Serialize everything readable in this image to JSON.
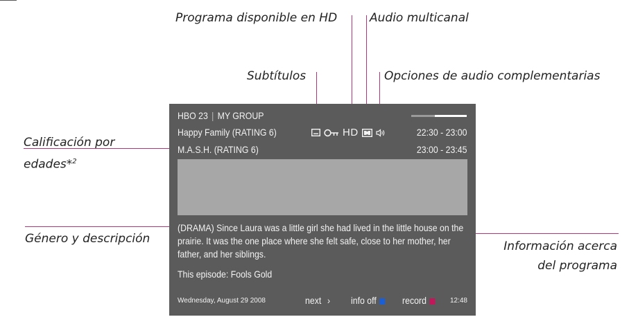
{
  "annotations": {
    "hd": "Programa disponible en HD",
    "multichannel": "Audio multicanal",
    "subtitles": "Subtítulos",
    "audio_options": "Opciones de audio complementarias",
    "age_rating_line1": "Calificación por",
    "age_rating_line2": "edades*",
    "age_rating_sup": "2",
    "genre": "Género y descripción",
    "info_line1": "Información acerca",
    "info_line2": "del programa"
  },
  "screen": {
    "channel": "HBO 23",
    "separator": "|",
    "group": "MY GROUP",
    "program1": "Happy Family (RATING 6)",
    "time1": "22:30 - 23:00",
    "program2": "M.A.S.H. (RATING 6)",
    "time2": "23:00 - 23:45",
    "hd_label": "HD",
    "description": "(DRAMA) Since Laura was a little girl she had lived in the little house on the prairie. It was the one place where she felt safe, close to her mother, her father, and her siblings.",
    "episode": "This episode: Fools Gold",
    "date": "Wednesday, August 29 2008",
    "next": "next",
    "next_arrow": "›",
    "info_off": "info off",
    "record": "record",
    "clock": "12:48"
  },
  "colors": {
    "annotation_line": "#b0357a",
    "info_button": "#1a5fd6",
    "record_button": "#c2185b",
    "screen_bg": "#5b5b5b",
    "image_placeholder": "#a7a7a7"
  },
  "icons": [
    "subtitle-icon",
    "key-icon",
    "hd-icon",
    "dolby-icon",
    "speaker-icon"
  ]
}
